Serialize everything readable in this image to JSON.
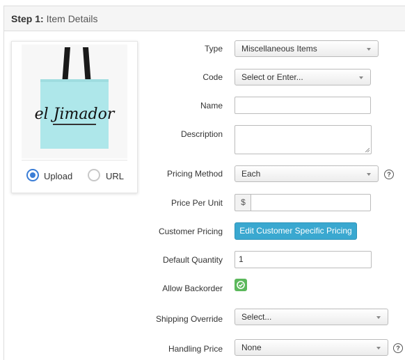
{
  "header": {
    "step": "Step 1:",
    "title": "Item Details"
  },
  "image_upload": {
    "product_image": "el Jimador tote bag",
    "brand_text": "el Jimador",
    "options": [
      {
        "label": "Upload",
        "selected": true
      },
      {
        "label": "URL",
        "selected": false
      }
    ]
  },
  "form": {
    "type": {
      "label": "Type",
      "value": "Miscellaneous Items"
    },
    "code": {
      "label": "Code",
      "value": "Select or Enter..."
    },
    "name": {
      "label": "Name",
      "value": ""
    },
    "description": {
      "label": "Description",
      "value": ""
    },
    "pricing_method": {
      "label": "Pricing Method",
      "value": "Each",
      "help": "?"
    },
    "price_per_unit": {
      "label": "Price Per Unit",
      "prefix": "$",
      "value": ""
    },
    "customer_pricing": {
      "label": "Customer Pricing",
      "button": "Edit Customer Specific Pricing"
    },
    "default_quantity": {
      "label": "Default Quantity",
      "value": "1"
    },
    "allow_backorder": {
      "label": "Allow Backorder",
      "checked": true
    },
    "shipping_override": {
      "label": "Shipping Override",
      "value": "Select..."
    },
    "handling_price": {
      "label": "Handling Price",
      "value": "None",
      "help": "?"
    }
  },
  "colors": {
    "accent": "#3a7dd6",
    "button": "#3aa8d0",
    "toggle": "#5cb85c",
    "bag": "#aee7ea"
  }
}
